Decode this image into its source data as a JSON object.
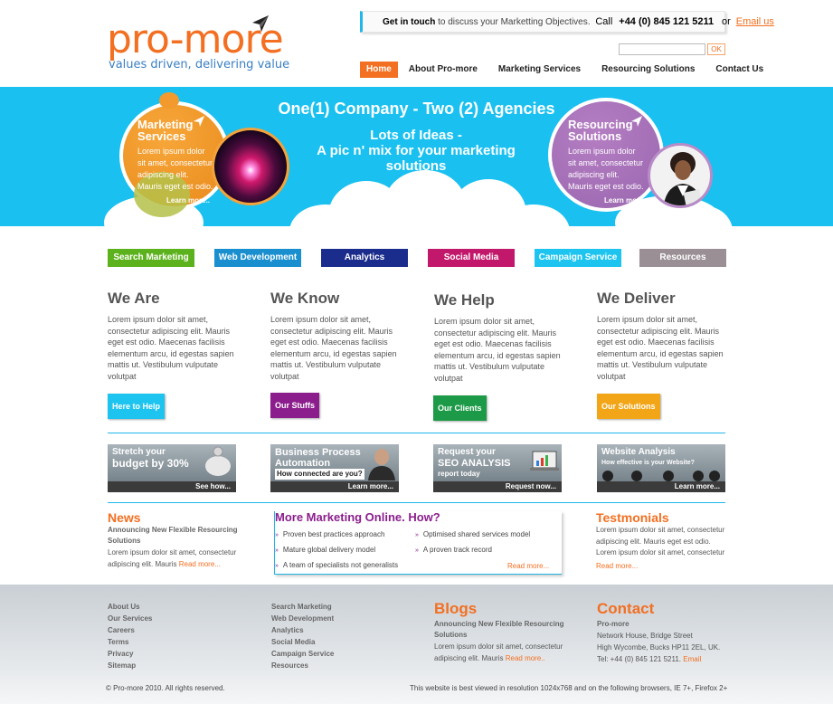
{
  "logo": {
    "name": "pro-more",
    "tagline": "values driven, delivering value"
  },
  "header": {
    "contact_prefix": "Get in touch",
    "contact_text": "to discuss your Marketting Objectives.",
    "call_label": "Call",
    "phone": "+44 (0) 845 121 5211",
    "or": "or",
    "email_link": "Email us",
    "search_placeholder": "",
    "search_button": "OK"
  },
  "nav": [
    {
      "label": "Home",
      "active": true
    },
    {
      "label": "About Pro-more"
    },
    {
      "label": "Marketing Services"
    },
    {
      "label": "Resourcing Solutions"
    },
    {
      "label": "Contact Us"
    }
  ],
  "hero": {
    "title": "One(1) Company - Two (2) Agencies",
    "subtitle_line1": "Lots of Ideas -",
    "subtitle_line2": "A pic n' mix for your marketing",
    "subtitle_line3": "solutions",
    "left_bubble": {
      "title_line1": "Marketing",
      "title_line2": "Services",
      "text": [
        "Lorem ipsum dolor",
        "sit amet, consectetur",
        "adipiscing elit.",
        "Mauris eget est odio."
      ],
      "more": "Learn more.."
    },
    "right_bubble": {
      "title_line1": "Resourcing",
      "title_line2": "Solutions",
      "text": [
        "Lorem ipsum dolor",
        "sit amet, consectetur",
        "adipiscing elit.",
        "Mauris eget est odio."
      ],
      "more": "Learn more.."
    }
  },
  "categories": [
    {
      "label": "Search Marketing",
      "color": "#5cb21c"
    },
    {
      "label": "Web Development",
      "color": "#1a8fcf"
    },
    {
      "label": "Analytics",
      "color": "#1a2c8c"
    },
    {
      "label": "Social Media",
      "color": "#c2186b"
    },
    {
      "label": "Campaign Service",
      "color": "#1cc4ef"
    },
    {
      "label": "Resources",
      "color": "#9a8f95"
    }
  ],
  "columns": [
    {
      "title": "We Are",
      "text": "Lorem ipsum dolor sit amet, consectetur adipiscing elit. Mauris eget est odio. Maecenas facilisis elementum arcu, id egestas sapien mattis ut. Vestibulum vulputate volutpat",
      "button": "Here to Help",
      "color": "#1cc4ef"
    },
    {
      "title": "We Know",
      "text": "Lorem ipsum dolor sit amet, consectetur adipiscing elit. Mauris eget est odio. Maecenas facilisis elementum arcu, id egestas sapien mattis ut. Vestibulum vulputate volutpat",
      "button": "Our Stuffs",
      "color": "#8b1d8c"
    },
    {
      "title": "We Help",
      "text": "Lorem ipsum dolor sit amet, consectetur adipiscing elit. Mauris eget est odio. Maecenas facilisis elementum arcu, id egestas sapien mattis ut. Vestibulum vulputate volutpat",
      "button": "Our Clients",
      "color": "#1d9a47"
    },
    {
      "title": "We Deliver",
      "text": "Lorem ipsum dolor sit amet, consectetur adipiscing elit. Mauris eget est odio. Maecenas facilisis elementum arcu, id egestas sapien mattis ut. Vestibulum vulputate volutpat",
      "button": "Our Solutions",
      "color": "#f2a516"
    }
  ],
  "promos": [
    {
      "line1": "Stretch your",
      "line2": "budget by 30%",
      "more": "See how..."
    },
    {
      "line1": "Business Process",
      "line2": "Automation",
      "line3": "How connected are you?",
      "more": "Learn more..."
    },
    {
      "line1": "Request your",
      "line2": "SEO ANALYSIS",
      "line3": "report today",
      "more": "Request now..."
    },
    {
      "line1": "Website Analysis",
      "line2": "How effective is your Website?",
      "more": "Learn more..."
    }
  ],
  "news": {
    "title": "News",
    "headline": "Announcing New Flexible Resourcing Solutions",
    "text": "Lorem ipsum dolor sit amet, consectetur adipiscing elit. Mauris",
    "more": "Read more..."
  },
  "marketing": {
    "title": "More Marketing Online. How?",
    "bullets_left": [
      "Proven best practices approach",
      "Mature global delivery model",
      "A team of specialists not generalists"
    ],
    "bullets_right": [
      "Optimised shared services model",
      "A proven track record"
    ],
    "more": "Read more..."
  },
  "testimonials": {
    "title": "Testmonials",
    "text": "Lorem ipsum dolor sit amet, consectetur adipiscing elit. Mauris eget est odio. Lorem ipsum dolor sit amet, consectetur",
    "more": "Read more..."
  },
  "footer": {
    "links1": [
      "About Us",
      "Our Services",
      "Careers",
      "Terms",
      "Privacy",
      "Sitemap"
    ],
    "links2": [
      "Search Marketing",
      "Web Development",
      "Analytics",
      "Social Media",
      "Campaign Service",
      "Resources"
    ],
    "blogs": {
      "title": "Blogs",
      "headline": "Announcing New Flexible Resourcing Solutions",
      "text": "Lorem ipsum dolor sit amet, consectetur adipiscing elit. Mauris",
      "more": "Read more.."
    },
    "contact": {
      "title": "Contact",
      "company": "Pro-more",
      "line1": "Network House, Bridge Street",
      "line2": "High Wycombe, Bucks HP11 2EL, UK.",
      "tel": "Tel: +44 (0) 845 121 5211.",
      "email": "Email"
    },
    "copyright": "© Pro-more 2010. All rights reserved.",
    "browser_note": "This website is best viewed in resolution 1024x768 and on the following browsers, IE 7+, Firefox 2+"
  }
}
